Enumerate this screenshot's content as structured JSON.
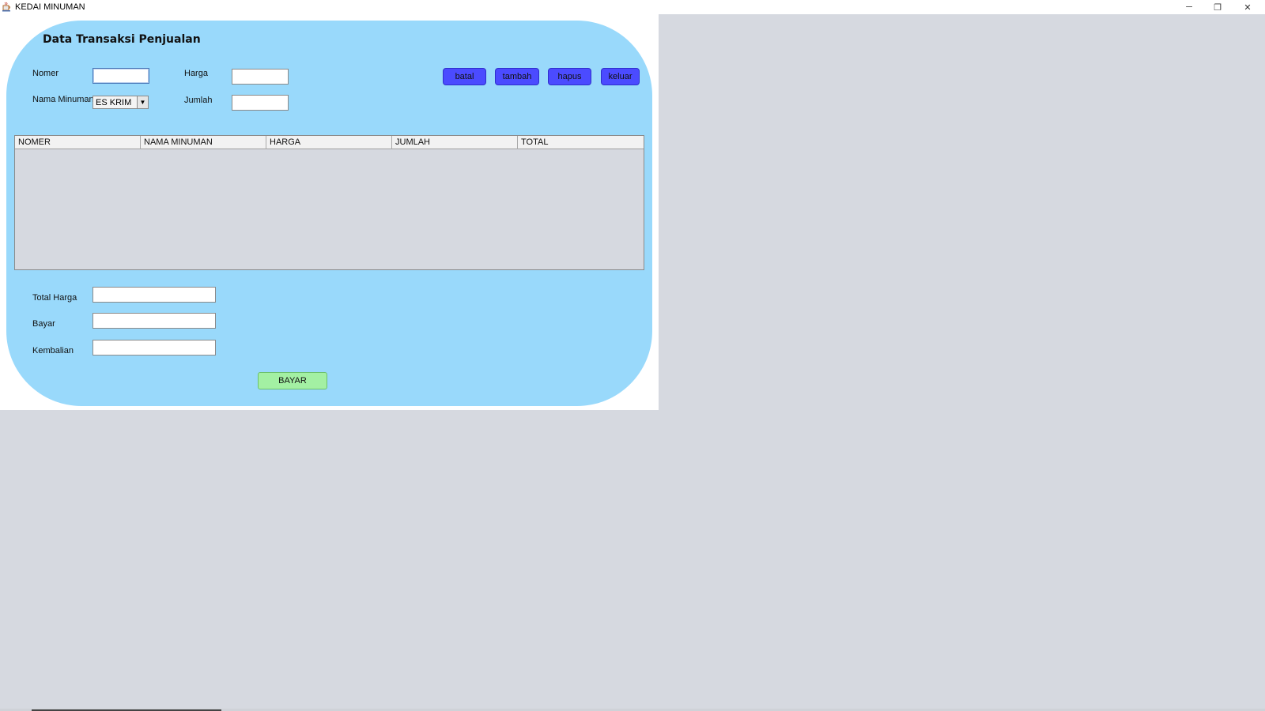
{
  "window": {
    "title": "KEDAI MINUMAN",
    "controls": {
      "minimize": "─",
      "maximize": "❐",
      "close": "✕"
    }
  },
  "form": {
    "heading": "Data Transaksi Penjualan",
    "nomer_label": "Nomer",
    "nomer_value": "",
    "harga_label": "Harga",
    "harga_value": "",
    "nama_minuman_label": "Nama Minuman",
    "nama_minuman_selected": "ES KRIM",
    "jumlah_label": "Jumlah",
    "jumlah_value": ""
  },
  "buttons": {
    "batal": "batal",
    "tambah": "tambah",
    "hapus": "hapus",
    "keluar": "keluar",
    "bayar": "BAYAR"
  },
  "table": {
    "columns": [
      "NOMER",
      "NAMA MINUMAN",
      "HARGA",
      "JUMLAH",
      "TOTAL"
    ],
    "rows": []
  },
  "summary": {
    "total_harga_label": "Total Harga",
    "total_harga_value": "",
    "bayar_label": "Bayar",
    "bayar_value": "",
    "kembalian_label": "Kembalian",
    "kembalian_value": ""
  },
  "colors": {
    "panel_bg": "#99d9fb",
    "blue_button": "#4b4bff",
    "green_button": "#a3f0a3",
    "desktop_bg": "#d6d9e0"
  },
  "icons": {
    "app": "java-cup-icon",
    "combo": "dropdown-arrow-icon"
  }
}
